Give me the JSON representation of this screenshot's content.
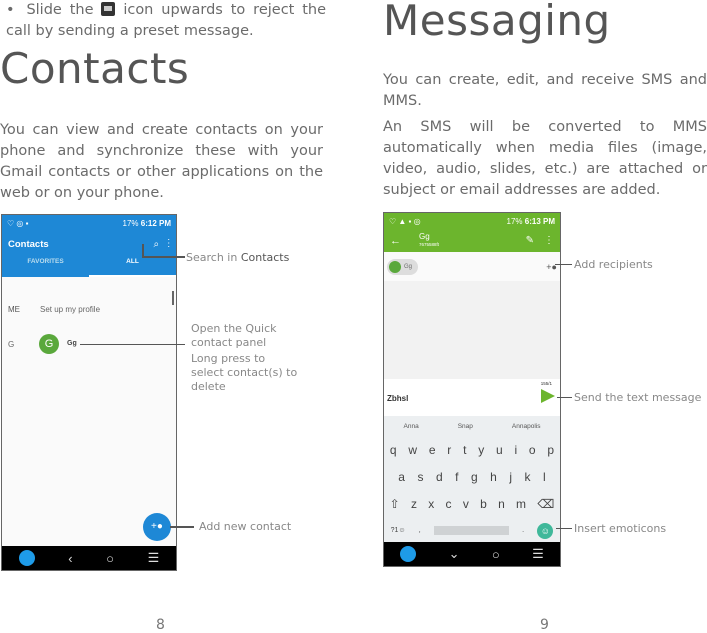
{
  "left": {
    "bullet": "•",
    "bullet_text_a": "Slide the",
    "bullet_text_b": "icon upwards to reject the call by sending a preset message.",
    "heading": "Contacts",
    "body": "You can view and create contacts on your phone and synchronize these with your Gmail contacts or other applications on the web or on your phone.",
    "phone": {
      "status_time": "6:12 PM",
      "status_battery": "17%",
      "title": "Contacts",
      "tabs": [
        "FAVORITES",
        "ALL"
      ],
      "me_label": "ME",
      "me_text": "Set up my profile",
      "group_letter": "G",
      "avatar_letter": "G",
      "contact_name": "Gg"
    },
    "callouts": {
      "search_a": "Search in",
      "search_b": "Contacts",
      "quick_1": "Open the Quick contact panel",
      "quick_2": "Long press to select contact(s) to delete",
      "add": "Add new contact"
    },
    "page_number": "8"
  },
  "right": {
    "heading": "Messaging",
    "body1": "You can create, edit, and receive SMS and MMS.",
    "body2": "An SMS will be converted to MMS automatically when media files (image, video, audio, slides, etc.) are attached or subject or email addresses are added.",
    "phone": {
      "status_time": "6:13 PM",
      "status_battery": "17%",
      "contact_name": "Gg",
      "contact_number": "7675588ft",
      "chip": "Gg",
      "counter": "155/1",
      "draft": "Zbhsl",
      "suggestions": [
        "Anna",
        "Snap",
        "Annapolis"
      ],
      "row1": [
        "q",
        "w",
        "e",
        "r",
        "t",
        "y",
        "u",
        "i",
        "o",
        "p"
      ],
      "row2": [
        "a",
        "s",
        "d",
        "f",
        "g",
        "h",
        "j",
        "k",
        "l"
      ],
      "row3": [
        "z",
        "x",
        "c",
        "v",
        "b",
        "n",
        "m"
      ],
      "sym_key": "?1☺",
      "comma": ",",
      "period": "."
    },
    "callouts": {
      "recipients": "Add recipients",
      "send": "Send the text message",
      "emoticons": "Insert emoticons"
    },
    "page_number": "9"
  },
  "colors": {
    "contacts_blue": "#1e88d6",
    "messaging_green": "#6cb52d",
    "avatar_green": "#5aa83c",
    "emoji_teal": "#3fb89a"
  }
}
